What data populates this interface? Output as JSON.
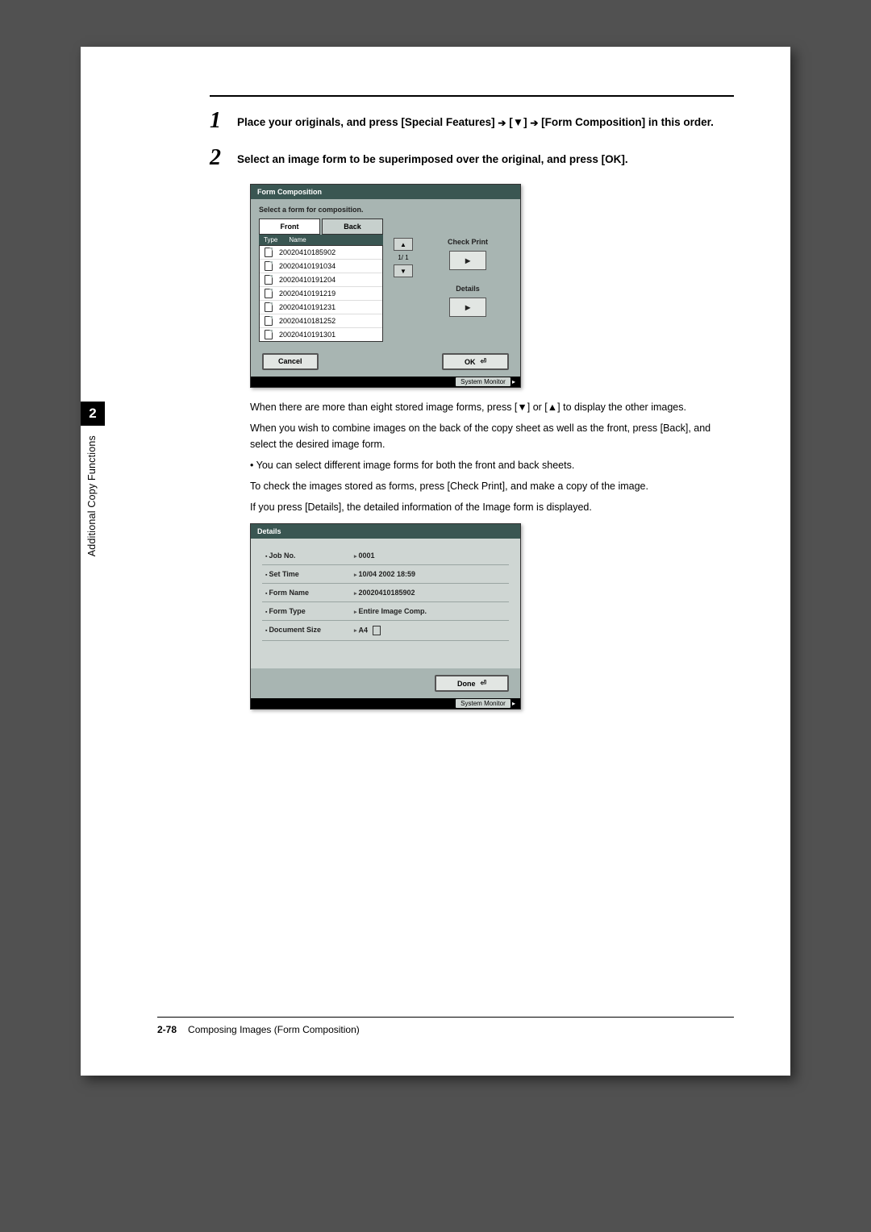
{
  "chapter": {
    "number": "2",
    "side_title": "Additional Copy Functions"
  },
  "steps": [
    {
      "num": "1",
      "text_parts": [
        "Place your originals, and press [Special Features] ",
        " [",
        "] ",
        " [Form Composition] in this order."
      ]
    },
    {
      "num": "2",
      "text": "Select an image form to be superimposed over the original, and press [OK]."
    }
  ],
  "form_comp": {
    "title": "Form Composition",
    "subtitle": "Select a form for composition.",
    "tabs": {
      "front": "Front",
      "back": "Back"
    },
    "headers": {
      "type": "Type",
      "name": "Name"
    },
    "rows": [
      "20020410185902",
      "20020410191034",
      "20020410191204",
      "20020410191219",
      "20020410191231",
      "20020410181252",
      "20020410191301"
    ],
    "page_indicator": "1/ 1",
    "check_print": "Check Print",
    "details": "Details",
    "cancel": "Cancel",
    "ok": "OK",
    "sysmon": "System Monitor"
  },
  "body": {
    "p1": "When there are more than eight stored image forms, press [▼] or [▲] to display the other images.",
    "p2": "When you wish to combine images on the back of the copy sheet as well as the front, press [Back], and select the desired image form.",
    "b1": "• You can select different image forms for both the front and back sheets.",
    "p3": "To check the images stored as forms, press [Check Print], and make a copy of the image.",
    "p4": "If you press [Details], the detailed information of the Image form is displayed."
  },
  "details": {
    "title": "Details",
    "rows": [
      {
        "k": "Job No.",
        "v": "0001"
      },
      {
        "k": "Set Time",
        "v": "10/04 2002 18:59"
      },
      {
        "k": "Form Name",
        "v": "20020410185902"
      },
      {
        "k": "Form Type",
        "v": "Entire Image Comp."
      },
      {
        "k": "Document Size",
        "v": "A4"
      }
    ],
    "done": "Done",
    "sysmon": "System Monitor"
  },
  "footer": {
    "page": "2-78",
    "title": "Composing Images (Form Composition)"
  }
}
